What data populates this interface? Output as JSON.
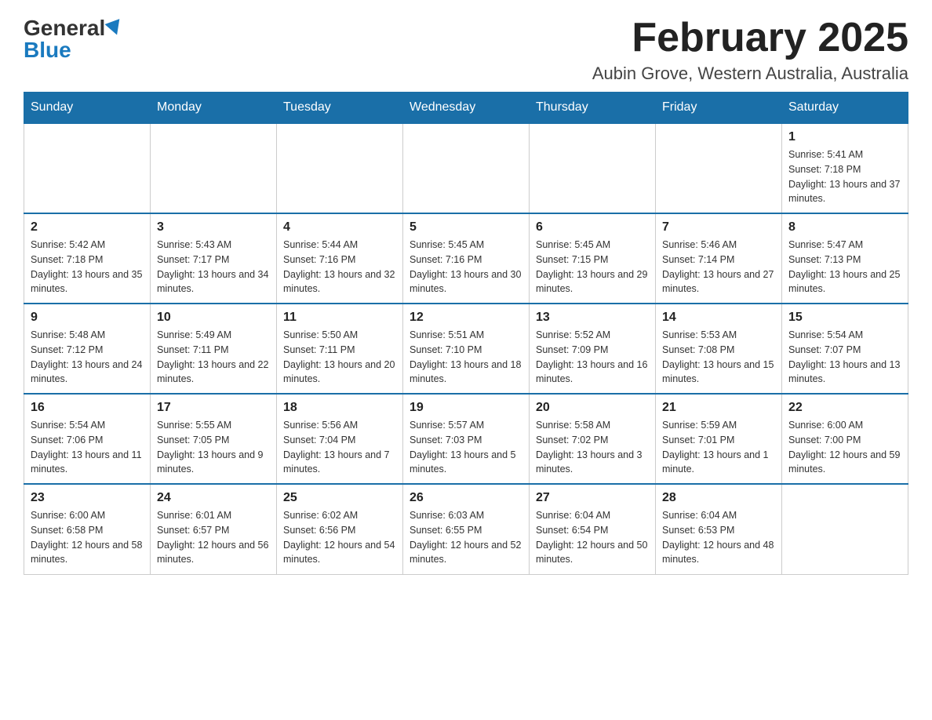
{
  "header": {
    "logo_general": "General",
    "logo_blue": "Blue",
    "month_title": "February 2025",
    "location": "Aubin Grove, Western Australia, Australia"
  },
  "weekdays": [
    "Sunday",
    "Monday",
    "Tuesday",
    "Wednesday",
    "Thursday",
    "Friday",
    "Saturday"
  ],
  "weeks": [
    [
      {
        "day": "",
        "info": ""
      },
      {
        "day": "",
        "info": ""
      },
      {
        "day": "",
        "info": ""
      },
      {
        "day": "",
        "info": ""
      },
      {
        "day": "",
        "info": ""
      },
      {
        "day": "",
        "info": ""
      },
      {
        "day": "1",
        "info": "Sunrise: 5:41 AM\nSunset: 7:18 PM\nDaylight: 13 hours and 37 minutes."
      }
    ],
    [
      {
        "day": "2",
        "info": "Sunrise: 5:42 AM\nSunset: 7:18 PM\nDaylight: 13 hours and 35 minutes."
      },
      {
        "day": "3",
        "info": "Sunrise: 5:43 AM\nSunset: 7:17 PM\nDaylight: 13 hours and 34 minutes."
      },
      {
        "day": "4",
        "info": "Sunrise: 5:44 AM\nSunset: 7:16 PM\nDaylight: 13 hours and 32 minutes."
      },
      {
        "day": "5",
        "info": "Sunrise: 5:45 AM\nSunset: 7:16 PM\nDaylight: 13 hours and 30 minutes."
      },
      {
        "day": "6",
        "info": "Sunrise: 5:45 AM\nSunset: 7:15 PM\nDaylight: 13 hours and 29 minutes."
      },
      {
        "day": "7",
        "info": "Sunrise: 5:46 AM\nSunset: 7:14 PM\nDaylight: 13 hours and 27 minutes."
      },
      {
        "day": "8",
        "info": "Sunrise: 5:47 AM\nSunset: 7:13 PM\nDaylight: 13 hours and 25 minutes."
      }
    ],
    [
      {
        "day": "9",
        "info": "Sunrise: 5:48 AM\nSunset: 7:12 PM\nDaylight: 13 hours and 24 minutes."
      },
      {
        "day": "10",
        "info": "Sunrise: 5:49 AM\nSunset: 7:11 PM\nDaylight: 13 hours and 22 minutes."
      },
      {
        "day": "11",
        "info": "Sunrise: 5:50 AM\nSunset: 7:11 PM\nDaylight: 13 hours and 20 minutes."
      },
      {
        "day": "12",
        "info": "Sunrise: 5:51 AM\nSunset: 7:10 PM\nDaylight: 13 hours and 18 minutes."
      },
      {
        "day": "13",
        "info": "Sunrise: 5:52 AM\nSunset: 7:09 PM\nDaylight: 13 hours and 16 minutes."
      },
      {
        "day": "14",
        "info": "Sunrise: 5:53 AM\nSunset: 7:08 PM\nDaylight: 13 hours and 15 minutes."
      },
      {
        "day": "15",
        "info": "Sunrise: 5:54 AM\nSunset: 7:07 PM\nDaylight: 13 hours and 13 minutes."
      }
    ],
    [
      {
        "day": "16",
        "info": "Sunrise: 5:54 AM\nSunset: 7:06 PM\nDaylight: 13 hours and 11 minutes."
      },
      {
        "day": "17",
        "info": "Sunrise: 5:55 AM\nSunset: 7:05 PM\nDaylight: 13 hours and 9 minutes."
      },
      {
        "day": "18",
        "info": "Sunrise: 5:56 AM\nSunset: 7:04 PM\nDaylight: 13 hours and 7 minutes."
      },
      {
        "day": "19",
        "info": "Sunrise: 5:57 AM\nSunset: 7:03 PM\nDaylight: 13 hours and 5 minutes."
      },
      {
        "day": "20",
        "info": "Sunrise: 5:58 AM\nSunset: 7:02 PM\nDaylight: 13 hours and 3 minutes."
      },
      {
        "day": "21",
        "info": "Sunrise: 5:59 AM\nSunset: 7:01 PM\nDaylight: 13 hours and 1 minute."
      },
      {
        "day": "22",
        "info": "Sunrise: 6:00 AM\nSunset: 7:00 PM\nDaylight: 12 hours and 59 minutes."
      }
    ],
    [
      {
        "day": "23",
        "info": "Sunrise: 6:00 AM\nSunset: 6:58 PM\nDaylight: 12 hours and 58 minutes."
      },
      {
        "day": "24",
        "info": "Sunrise: 6:01 AM\nSunset: 6:57 PM\nDaylight: 12 hours and 56 minutes."
      },
      {
        "day": "25",
        "info": "Sunrise: 6:02 AM\nSunset: 6:56 PM\nDaylight: 12 hours and 54 minutes."
      },
      {
        "day": "26",
        "info": "Sunrise: 6:03 AM\nSunset: 6:55 PM\nDaylight: 12 hours and 52 minutes."
      },
      {
        "day": "27",
        "info": "Sunrise: 6:04 AM\nSunset: 6:54 PM\nDaylight: 12 hours and 50 minutes."
      },
      {
        "day": "28",
        "info": "Sunrise: 6:04 AM\nSunset: 6:53 PM\nDaylight: 12 hours and 48 minutes."
      },
      {
        "day": "",
        "info": ""
      }
    ]
  ]
}
